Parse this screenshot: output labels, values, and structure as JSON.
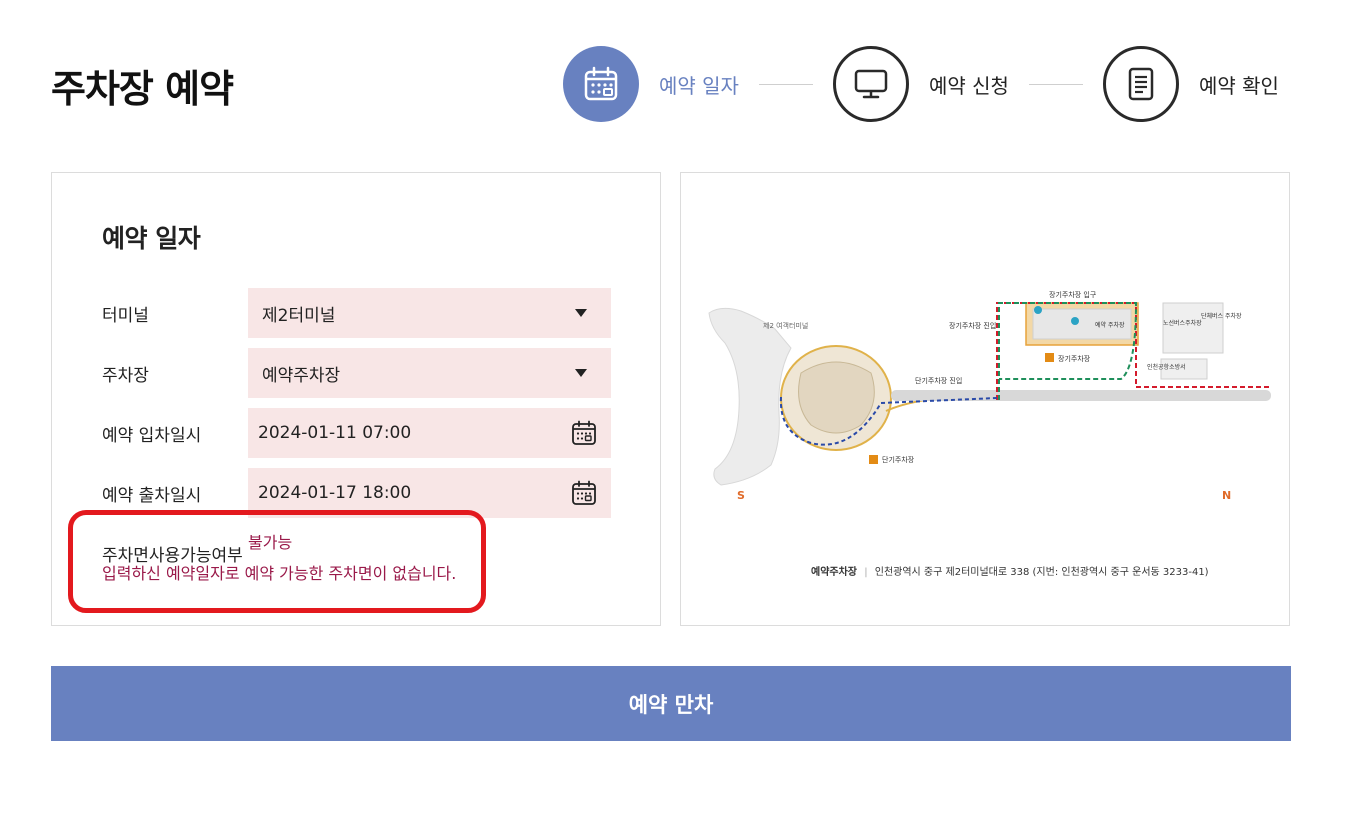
{
  "page": {
    "title": "주차장 예약"
  },
  "steps": [
    {
      "label": "예약 일자",
      "icon": "calendar-icon",
      "active": true
    },
    {
      "label": "예약 신청",
      "icon": "monitor-icon",
      "active": false
    },
    {
      "label": "예약 확인",
      "icon": "document-icon",
      "active": false
    }
  ],
  "form": {
    "heading": "예약 일자",
    "terminal": {
      "label": "터미널",
      "value": "제2터미널"
    },
    "parking": {
      "label": "주차장",
      "value": "예약주차장"
    },
    "entry": {
      "label": "예약 입차일시",
      "value": "2024-01-11 07:00"
    },
    "exit": {
      "label": "예약 출차일시",
      "value": "2024-01-17 18:00"
    },
    "availability": {
      "label": "주차면사용가능여부",
      "status": "불가능",
      "message": "입력하신 예약일자로 예약 가능한 주차면이 없습니다."
    }
  },
  "map": {
    "labels": {
      "terminal2": "제2 여객터미널",
      "long_term_entrance": "장기주차장 입구",
      "long_term_entry": "장기주차장 진입",
      "long_term_lot": "장기주차장",
      "short_term_entry": "단기주차장 진입",
      "short_term_lot": "단기주차장",
      "bus_lot": "노선버스주차장",
      "group_bus_lot": "단체버스 주차장",
      "fire_station": "인천공항소방서",
      "reserved_lot": "예약 주차장",
      "south": "S",
      "north": "N"
    },
    "footer_name": "예약주차장",
    "footer_address": "인천광역시 중구 제2터미널대로 338 (지번: 인천광역시 중구 운서동 3233-41)"
  },
  "submit": {
    "label": "예약 만차"
  },
  "colors": {
    "accent": "#6881c0",
    "field_bg": "#f8e6e6",
    "error": "#9a1a4a",
    "highlight": "#e3191e"
  }
}
